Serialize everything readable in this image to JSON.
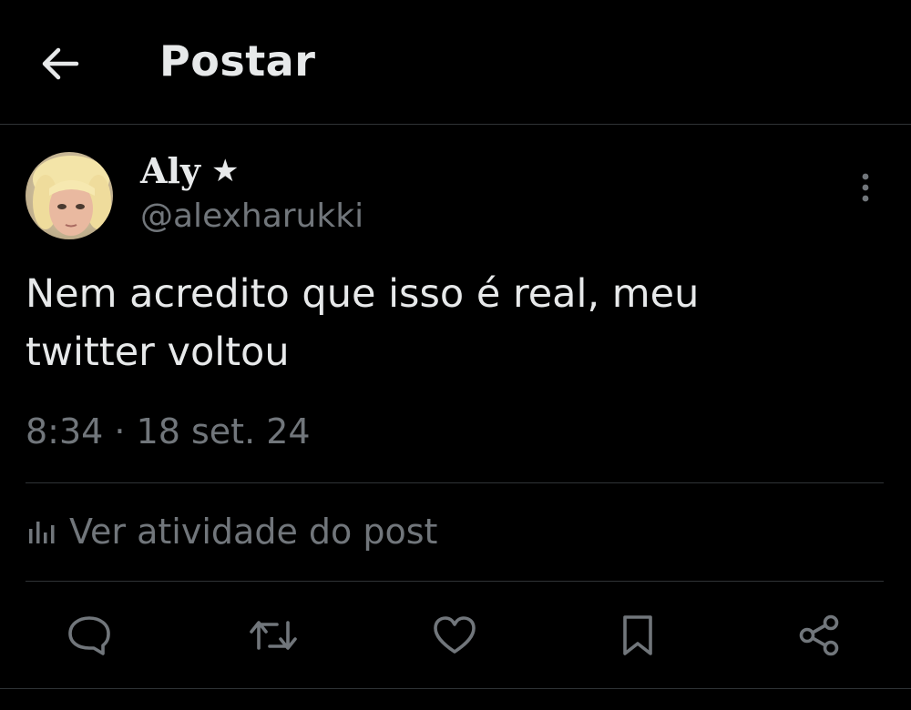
{
  "header": {
    "back_icon": "arrow-left-icon",
    "title": "Postar"
  },
  "post": {
    "author": {
      "display_name": "Aly",
      "badge": "★",
      "handle": "@alexharukki",
      "avatar_icon": "user-avatar"
    },
    "text": "Nem acredito que isso é real, meu\ntwitter voltou",
    "timestamp": "8:34 · 18 set. 24",
    "activity_label": "Ver atividade do post"
  },
  "actions": [
    {
      "name": "reply",
      "icon": "comment-icon"
    },
    {
      "name": "repost",
      "icon": "repost-icon"
    },
    {
      "name": "like",
      "icon": "heart-icon"
    },
    {
      "name": "bookmark",
      "icon": "bookmark-icon"
    },
    {
      "name": "share",
      "icon": "share-icon"
    }
  ],
  "colors": {
    "background": "#000000",
    "text_primary": "#e7e9ea",
    "text_secondary": "#71767b",
    "divider": "#2f3336"
  }
}
